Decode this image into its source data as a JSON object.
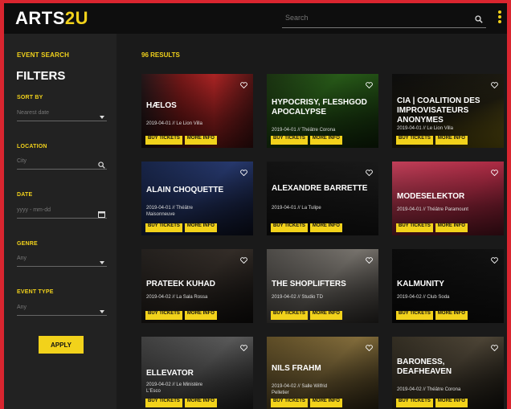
{
  "app": {
    "logo_main": "ARTS",
    "logo_accent": "2U"
  },
  "search": {
    "placeholder": "Search"
  },
  "sidebar": {
    "kicker": "EVENT SEARCH",
    "title": "FILTERS",
    "fields": [
      {
        "label": "SORT BY",
        "value": "Nearest date",
        "icon": "chevron-down-icon"
      },
      {
        "label": "LOCATION",
        "value": "City",
        "icon": "search-icon"
      },
      {
        "label": "DATE",
        "value": "yyyy - mm-dd",
        "icon": "calendar-icon"
      },
      {
        "label": "GENRE",
        "value": "Any",
        "icon": "chevron-down-icon"
      },
      {
        "label": "EVENT TYPE",
        "value": "Any",
        "icon": "chevron-down-icon"
      }
    ],
    "apply_label": "APPLY"
  },
  "results": {
    "count_label": "96 RESULTS"
  },
  "colors": {
    "accent": "#f2d21b",
    "brand_frame": "#d9252f",
    "background": "#1a1a1a",
    "sidebar": "#222222",
    "topbar": "#0e0e0e"
  },
  "cards": [
    {
      "name": "HÆLOS",
      "line1": "2019-04-01 // Le Lion Villa",
      "line2": "",
      "buy": "BUY TICKETS",
      "more": "MORE INFO",
      "bg": "linear-gradient(90deg,#2a1b1d 0%,#8a1c1c 35%,#c92a2a 65%,#5e1818 100%)"
    },
    {
      "name": "HYPOCRISY, FLESHGOD APOCALYPSE",
      "line1": "2019-04-01 // Théâtre Corona",
      "line2": "",
      "buy": "BUY TICKETS",
      "more": "MORE INFO",
      "bg": "linear-gradient(135deg,#1f3a14 0%,#2f6b1d 40%,#183a0e 100%)"
    },
    {
      "name": "CIA | COALITION DES IMPROVISATEURS ANONYMES",
      "line1": "2019-04-01 // Le Lion Villa",
      "line2": "",
      "buy": "BUY TICKETS",
      "more": "MORE INFO",
      "bg": "linear-gradient(160deg,#0f0f0f 0%,#2a2615 55%,#b29a18 100%)"
    },
    {
      "name": "ALAIN CHOQUETTE",
      "line1": "2019-04-01 // Théâtre",
      "line2": "Maisonneuve",
      "buy": "BUY TICKETS",
      "more": "MORE INFO",
      "bg": "linear-gradient(135deg,#1b2a52 0%,#2d4280 50%,#141b36 100%)"
    },
    {
      "name": "ALEXANDRE BARRETTE",
      "line1": "2019-04-01 // La Tulipe",
      "line2": "",
      "buy": "BUY TICKETS",
      "more": "MORE INFO",
      "bg": "linear-gradient(135deg,#161616 0%,#232323 100%)"
    },
    {
      "name": "MODESELEKTOR",
      "line1": "2019-04-01 // Théâtre Paramount",
      "line2": "",
      "buy": "BUY TICKETS",
      "more": "MORE INFO",
      "bg": "linear-gradient(135deg,#e24a68 0%,#c8324f 60%,#8f1f35 100%)"
    },
    {
      "name": "PRATEEK KUHAD",
      "line1": "2019-04-02 // La Sala Rossa",
      "line2": "",
      "buy": "BUY TICKETS",
      "more": "MORE INFO",
      "bg": "linear-gradient(135deg,#2a2623 0%,#3d352f 50%,#1b1816 100%)"
    },
    {
      "name": "THE SHOPLIFTERS",
      "line1": "2019-04-02 // Studio TD",
      "line2": "",
      "buy": "BUY TICKETS",
      "more": "MORE INFO",
      "bg": "linear-gradient(135deg,#5a5753 0%,#8c8780 50%,#4a4642 100%)"
    },
    {
      "name": "KALMUNITY",
      "line1": "2019-04-02 // Club Soda",
      "line2": "",
      "buy": "BUY TICKETS",
      "more": "MORE INFO",
      "bg": "linear-gradient(135deg,#0d0d0d 0%,#1a1a1a 100%)"
    },
    {
      "name": "ELLEVATOR",
      "line1": "2019-04-02 // Le Ministère",
      "line2": "L'Esco",
      "buy": "BUY TICKETS",
      "more": "MORE INFO",
      "bg": "linear-gradient(135deg,#4b4b4b 0%,#6a6a6a 50%,#333 100%)"
    },
    {
      "name": "NILS FRAHM",
      "line1": "2019-04-02 // Salle Wilfrid",
      "line2": "Pelletier",
      "buy": "BUY TICKETS",
      "more": "MORE INFO",
      "bg": "linear-gradient(135deg,#6e5a2d 0%,#9a8046 50%,#4b3e20 100%)"
    },
    {
      "name": "BARONESS, DEAFHEAVEN",
      "line1": "2019-04-02 // Théâtre Corona",
      "line2": "",
      "buy": "BUY TICKETS",
      "more": "MORE INFO",
      "bg": "linear-gradient(135deg,#3b3528 0%,#5b5140 50%,#221e17 100%)"
    }
  ]
}
